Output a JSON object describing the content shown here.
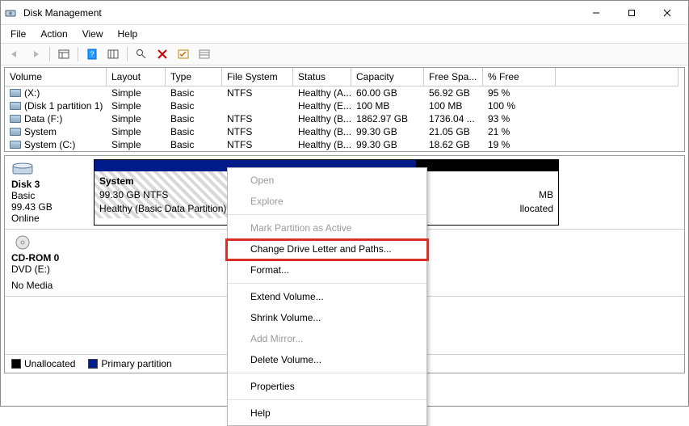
{
  "window": {
    "title": "Disk Management"
  },
  "menu": [
    "File",
    "Action",
    "View",
    "Help"
  ],
  "columns": [
    "Volume",
    "Layout",
    "Type",
    "File System",
    "Status",
    "Capacity",
    "Free Spa...",
    "% Free"
  ],
  "volumes": [
    {
      "name": "(X:)",
      "layout": "Simple",
      "type": "Basic",
      "fs": "NTFS",
      "status": "Healthy (A...",
      "capacity": "60.00 GB",
      "free": "56.92 GB",
      "pct": "95 %"
    },
    {
      "name": "(Disk 1 partition 1)",
      "layout": "Simple",
      "type": "Basic",
      "fs": "",
      "status": "Healthy (E...",
      "capacity": "100 MB",
      "free": "100 MB",
      "pct": "100 %"
    },
    {
      "name": "Data (F:)",
      "layout": "Simple",
      "type": "Basic",
      "fs": "NTFS",
      "status": "Healthy (B...",
      "capacity": "1862.97 GB",
      "free": "1736.04 ...",
      "pct": "93 %"
    },
    {
      "name": "System",
      "layout": "Simple",
      "type": "Basic",
      "fs": "NTFS",
      "status": "Healthy (B...",
      "capacity": "99.30 GB",
      "free": "21.05 GB",
      "pct": "21 %"
    },
    {
      "name": "System (C:)",
      "layout": "Simple",
      "type": "Basic",
      "fs": "NTFS",
      "status": "Healthy (B...",
      "capacity": "99.30 GB",
      "free": "18.62 GB",
      "pct": "19 %"
    }
  ],
  "disk3": {
    "label": "Disk 3",
    "type": "Basic",
    "size": "99.43 GB",
    "status": "Online",
    "partSystem": {
      "name": "System",
      "line2": "99.30 GB NTFS",
      "line3": "Healthy (Basic Data Partition)"
    },
    "partUnalloc": {
      "line1": "MB",
      "line2": "llocated"
    }
  },
  "cdrom": {
    "label": "CD-ROM 0",
    "sub": "DVD (E:)",
    "status": "No Media"
  },
  "legend": {
    "unalloc": "Unallocated",
    "primary": "Primary partition"
  },
  "ctx": {
    "open": "Open",
    "explore": "Explore",
    "mark": "Mark Partition as Active",
    "change": "Change Drive Letter and Paths...",
    "format": "Format...",
    "extend": "Extend Volume...",
    "shrink": "Shrink Volume...",
    "mirror": "Add Mirror...",
    "delete": "Delete Volume...",
    "props": "Properties",
    "help": "Help"
  }
}
